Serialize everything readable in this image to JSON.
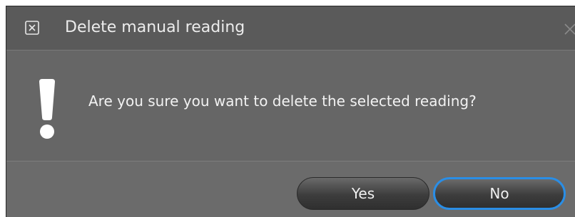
{
  "dialog": {
    "title": "Delete manual reading",
    "title_icon": "close-box-icon",
    "close_icon": "close-icon",
    "message": "Are you sure you want to delete the selected reading?",
    "message_icon": "exclamation-icon",
    "buttons": {
      "yes_label": "Yes",
      "no_label": "No"
    },
    "colors": {
      "background": "#616161",
      "text": "#f2f2f2",
      "focus_ring": "#2a8ee6"
    }
  }
}
